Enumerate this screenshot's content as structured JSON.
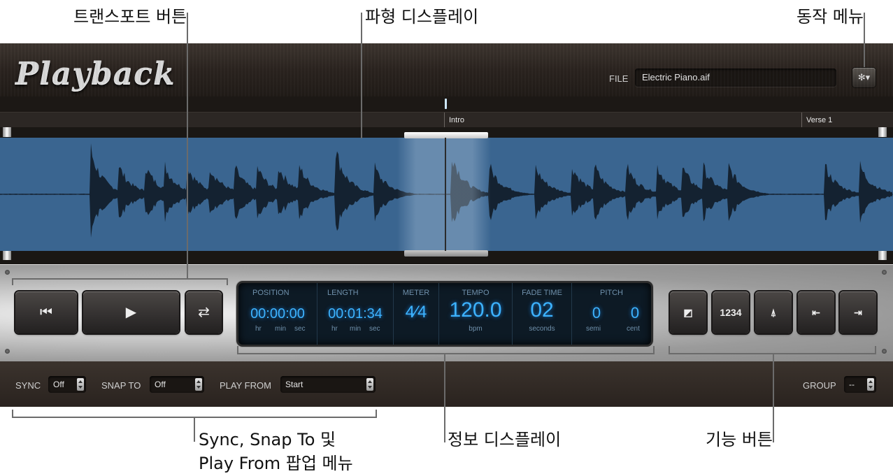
{
  "callouts": {
    "transport": "트랜스포트 버튼",
    "waveform": "파형 디스플레이",
    "action_menu": "동작 메뉴",
    "popups_line1": "Sync, Snap To 및",
    "popups_line2": "Play From 팝업 메뉴",
    "info_display": "정보 디스플레이",
    "function_buttons": "기능 버튼"
  },
  "header": {
    "logo": "Playback",
    "file_label": "FILE",
    "file_name": "Electric Piano.aif",
    "action_icon": "gear-icon",
    "action_glyph": "✻▾"
  },
  "markers": [
    "Intro",
    "Verse 1"
  ],
  "transport": {
    "rewind_icon": "go-to-start-icon",
    "rewind_glyph": "⏮",
    "play_icon": "play-icon",
    "play_glyph": "▶",
    "loop_icon": "cycle-icon",
    "loop_glyph": "⇄"
  },
  "info": {
    "position": {
      "title": "POSITION",
      "value": "00:00:00",
      "units": [
        "hr",
        "min",
        "sec"
      ]
    },
    "length": {
      "title": "LENGTH",
      "value": "00:01:34",
      "units": [
        "hr",
        "min",
        "sec"
      ]
    },
    "meter": {
      "title": "METER",
      "value": "4⁄4"
    },
    "tempo": {
      "title": "TEMPO",
      "value": "120.0",
      "unit": "bpm"
    },
    "fade_time": {
      "title": "FADE TIME",
      "value": "02",
      "unit": "seconds"
    },
    "pitch": {
      "title": "PITCH",
      "semi_value": "0",
      "cent_value": "0",
      "semi_unit": "semi",
      "cent_unit": "cent"
    }
  },
  "function_buttons": [
    {
      "icon": "fade-icon",
      "glyph": "◩"
    },
    {
      "icon": "count-in-icon",
      "glyph": "1234"
    },
    {
      "icon": "metronome-icon",
      "glyph": "⍋"
    },
    {
      "icon": "move-region-left-icon",
      "glyph": "⇤"
    },
    {
      "icon": "move-region-right-icon",
      "glyph": "⇥"
    }
  ],
  "bottom": {
    "sync_label": "SYNC",
    "sync_value": "Off",
    "snap_label": "SNAP TO",
    "snap_value": "Off",
    "playfrom_label": "PLAY FROM",
    "playfrom_value": "Start",
    "group_label": "GROUP",
    "group_value": "--"
  },
  "colors": {
    "waveform_bg": "#3a6590",
    "display_text": "#3db3ff",
    "frame": "#2a231f"
  }
}
